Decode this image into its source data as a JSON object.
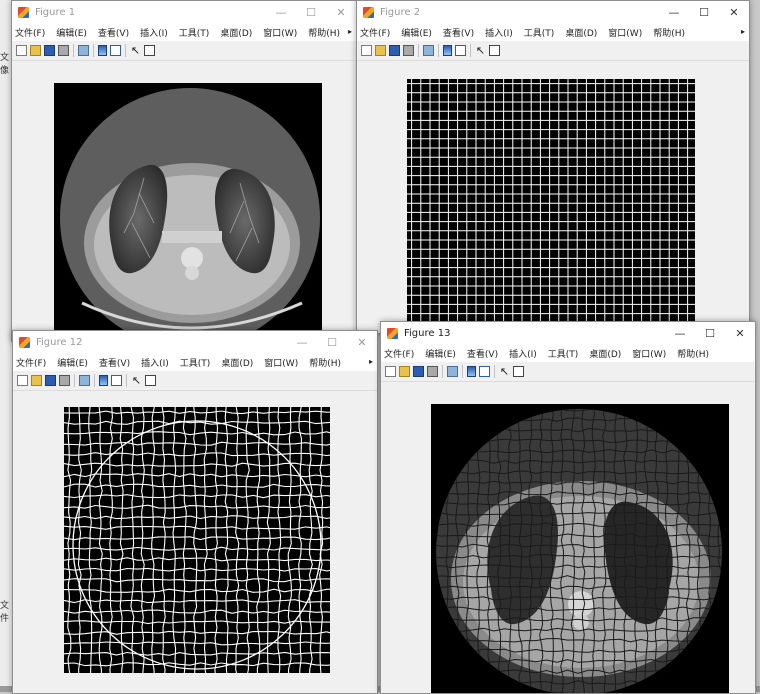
{
  "menus": [
    "文件(F)",
    "编辑(E)",
    "查看(V)",
    "插入(I)",
    "工具(T)",
    "桌面(D)",
    "窗口(W)",
    "帮助(H)"
  ],
  "background_fragments": [
    "文像",
    "文件"
  ],
  "windows": {
    "fig1": {
      "title": "Figure 1"
    },
    "fig2": {
      "title": "Figure 2"
    },
    "fig12": {
      "title": "Figure 12"
    },
    "fig13": {
      "title": "Figure 13"
    }
  },
  "window_controls": {
    "minimize": "—",
    "maximize": "☐",
    "close": "✕"
  },
  "toolbar_icons": [
    "new-figure-icon",
    "open-file-icon",
    "save-icon",
    "print-icon",
    "link-plot-icon",
    "insert-colorbar-icon",
    "insert-legend-icon",
    "edit-plot-arrow-icon",
    "plot-browser-icon"
  ],
  "colors": {
    "window_bg": "#f0f0f0",
    "titlebar": "#ffffff",
    "plot_bg": "#000000",
    "grid": "#ffffff"
  }
}
